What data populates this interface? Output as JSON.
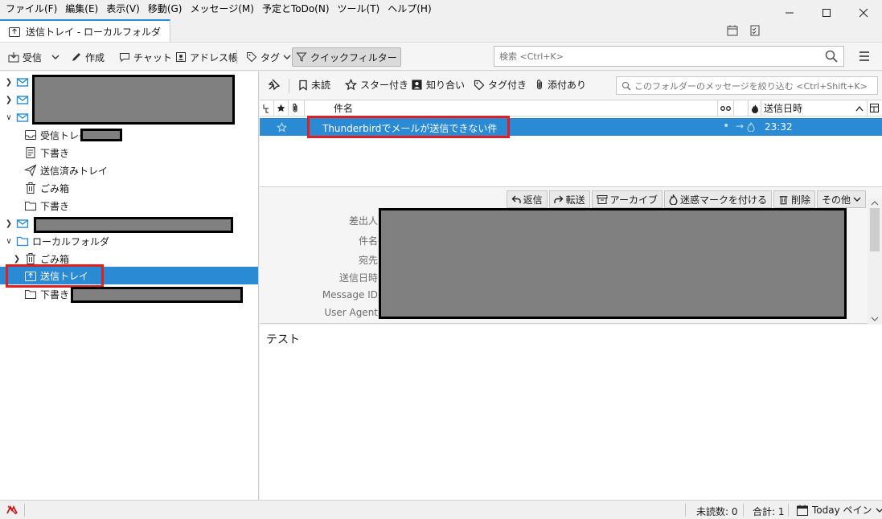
{
  "menu": [
    "ファイル(F)",
    "編集(E)",
    "表示(V)",
    "移動(G)",
    "メッセージ(M)",
    "予定とToDo(N)",
    "ツール(T)",
    "ヘルプ(H)"
  ],
  "tab": {
    "label": "送信トレイ - ローカルフォルダ"
  },
  "toolbar": {
    "get_mail": "受信",
    "write": "作成",
    "chat": "チャット",
    "address_book": "アドレス帳",
    "tag": "タグ",
    "quick_filter": "クイックフィルター",
    "search_placeholder": "検索 <Ctrl+K>"
  },
  "folders": {
    "inbox": "受信トレイ",
    "drafts_1": "下書き",
    "sent": "送信済みトレイ",
    "trash_1": "ごみ箱",
    "drafts_2": "下書き",
    "local_folders": "ローカルフォルダ",
    "trash_local": "ごみ箱",
    "outbox": "送信トレイ",
    "drafts_local": "下書き"
  },
  "quick_filter": {
    "unread": "未読",
    "starred": "スター付き",
    "contacts": "知り合い",
    "tags": "タグ付き",
    "attachments": "添付あり",
    "filter_placeholder": "このフォルダーのメッセージを絞り込む <Ctrl+Shift+K>"
  },
  "thread": {
    "col_subject": "件名",
    "col_date": "送信日時",
    "rows": [
      {
        "subject": "Thunderbirdでメールが送信できない件",
        "date": "23:32"
      }
    ]
  },
  "message": {
    "actions": {
      "reply": "返信",
      "forward": "転送",
      "archive": "アーカイブ",
      "junk": "迷惑マークを付ける",
      "delete": "削除",
      "other": "その他"
    },
    "labels": {
      "from": "差出人",
      "subject": "件名",
      "to": "宛先",
      "date": "送信日時",
      "message_id": "Message ID",
      "user_agent": "User Agent"
    },
    "body": "テスト"
  },
  "status": {
    "unread": "未読数: 0",
    "total": "合計: 1",
    "today_pane": "Today ペイン"
  },
  "colors": {
    "accent": "#2a8ad4",
    "highlight": "#e02020",
    "redaction": "#808080"
  }
}
